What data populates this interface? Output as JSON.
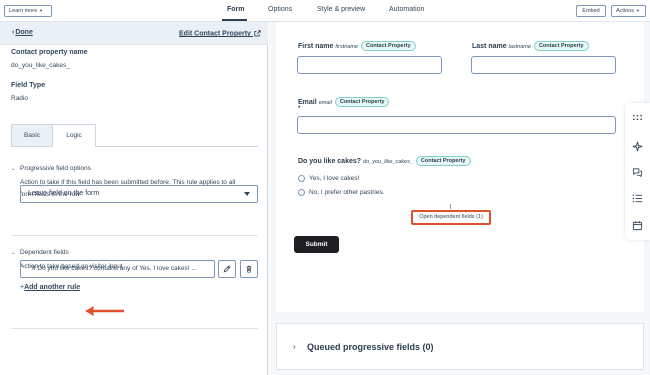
{
  "topbar": {
    "learn_more": "Learn more",
    "embed": "Embed",
    "actions": "Actions",
    "tabs": [
      {
        "label": "Form",
        "active": true
      },
      {
        "label": "Options",
        "active": false
      },
      {
        "label": "Style & preview",
        "active": false
      },
      {
        "label": "Automation",
        "active": false
      }
    ]
  },
  "left": {
    "done": "Done",
    "edit_property": "Edit Contact Property",
    "property_name_label": "Contact property name",
    "property_name_value": "do_you_like_cakes_",
    "field_type_label": "Field Type",
    "field_type_value": "Radio",
    "subtabs": [
      "Basic",
      "Logic"
    ],
    "progressive": {
      "title": "Progressive field options",
      "description_line1": "Action to take if this field has been submitted before. This rule applies to all",
      "description_line2": "form fields in the row",
      "select_value": "Leave field on the form"
    },
    "dependent": {
      "title": "Dependent fields",
      "description": "Action to take based on visitor input",
      "rule_text": "If Do you like cakes? contains any of Yes, I love cakes! ...",
      "add_rule": "Add another rule"
    }
  },
  "form": {
    "first_name": {
      "label": "First name",
      "internal": "firstname",
      "pill": "Contact Property"
    },
    "last_name": {
      "label": "Last name",
      "internal": "lastname",
      "pill": "Contact Property"
    },
    "email": {
      "label": "Email",
      "internal": "email",
      "pill": "Contact Property",
      "required": "*"
    },
    "cakes": {
      "label": "Do you like cakes?",
      "internal": "do_you_like_cakes_",
      "pill": "Contact Property",
      "options": [
        "Yes, I love cakes!",
        "No, I prefer other pastries."
      ]
    },
    "dependent_button": "Open dependent fields (1)",
    "submit": "Submit"
  },
  "queued": {
    "title": "Queued progressive fields (0)"
  },
  "toolbar_icons": [
    "grid-dots-icon",
    "sparkle-icon",
    "chat-icon",
    "list-icon",
    "calendar-icon"
  ],
  "colors": {
    "highlight": "#e0522d",
    "pill_border": "#7fd1c7",
    "pill_bg": "#e5f8f6",
    "submit_bg": "#1d1f22"
  }
}
